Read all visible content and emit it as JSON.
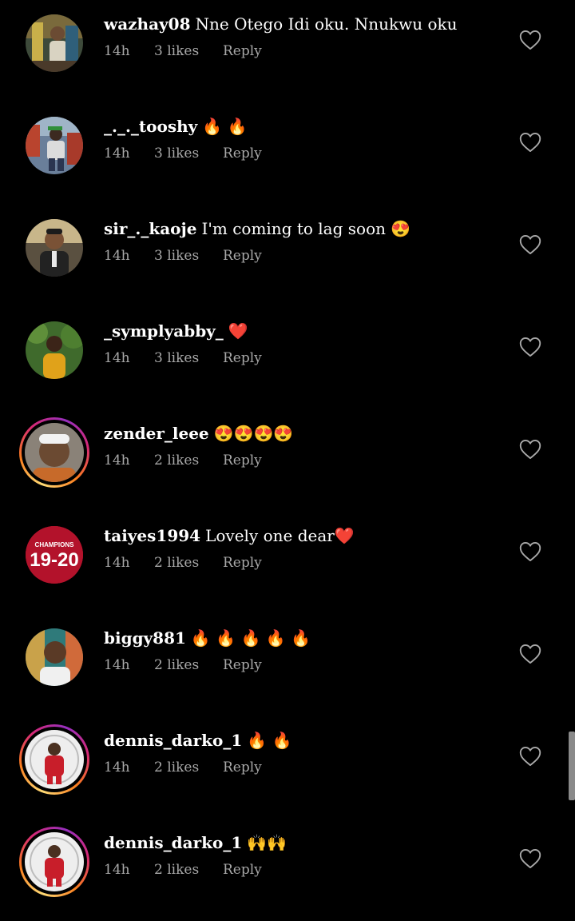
{
  "comments": [
    {
      "username": "wazhay08",
      "text": "Nne Otego Idi oku.  Nnukwu oku",
      "time": "14h",
      "likes": "3 likes",
      "reply": "Reply",
      "story": false
    },
    {
      "username": "_._._tooshy",
      "text": "🔥 🔥",
      "time": "14h",
      "likes": "3 likes",
      "reply": "Reply",
      "story": false
    },
    {
      "username": "sir_._kaoje",
      "text": "I'm coming to lag soon 😍",
      "time": "14h",
      "likes": "3 likes",
      "reply": "Reply",
      "story": false
    },
    {
      "username": "_symplyabby_",
      "text": "❤️",
      "time": "14h",
      "likes": "3 likes",
      "reply": "Reply",
      "story": false
    },
    {
      "username": "zender_leee",
      "text": "😍😍😍😍",
      "time": "14h",
      "likes": "2 likes",
      "reply": "Reply",
      "story": true
    },
    {
      "username": "taiyes1994",
      "text": "Lovely one dear❤️",
      "time": "14h",
      "likes": "2 likes",
      "reply": "Reply",
      "story": false
    },
    {
      "username": "biggy881",
      "text": "🔥 🔥 🔥 🔥 🔥",
      "time": "14h",
      "likes": "2 likes",
      "reply": "Reply",
      "story": false
    },
    {
      "username": "dennis_darko_1",
      "text": "🔥 🔥",
      "time": "14h",
      "likes": "2 likes",
      "reply": "Reply",
      "story": true
    },
    {
      "username": "dennis_darko_1",
      "text": "🙌🙌",
      "time": "14h",
      "likes": "2 likes",
      "reply": "Reply",
      "story": true
    }
  ],
  "avatar_text": {
    "taiyes1994": {
      "small": "CHAMPIONS",
      "big": "19-20"
    }
  },
  "colors": {
    "background": "#000000",
    "text": "#ffffff",
    "meta": "#a8a8a8",
    "heart_outline": "#a8a8a8",
    "scrollbar": "#8a8a8a"
  },
  "icons": {
    "like": "heart-outline-icon"
  }
}
